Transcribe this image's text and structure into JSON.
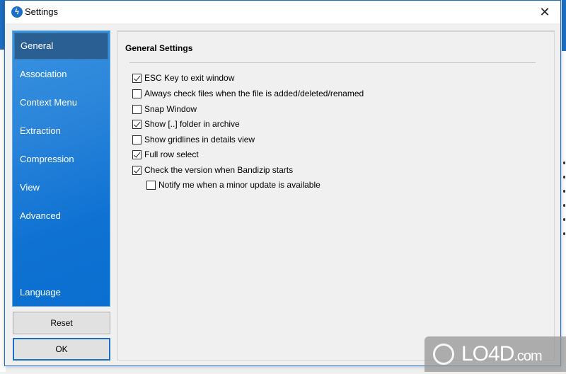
{
  "window": {
    "title": "Settings",
    "app_icon": "bandizip-bolt-icon",
    "close_glyph": "✕"
  },
  "sidebar": {
    "items": [
      {
        "label": "General",
        "active": true
      },
      {
        "label": "Association",
        "active": false
      },
      {
        "label": "Context Menu",
        "active": false
      },
      {
        "label": "Extraction",
        "active": false
      },
      {
        "label": "Compression",
        "active": false
      },
      {
        "label": "View",
        "active": false
      },
      {
        "label": "Advanced",
        "active": false
      },
      {
        "label": "Language",
        "active": false
      }
    ],
    "active_color": "#2a5f93",
    "background_color": "#0f72d3"
  },
  "buttons": {
    "reset_label": "Reset",
    "ok_label": "OK"
  },
  "general": {
    "section_title": "General Settings",
    "options": [
      {
        "label": "ESC Key to exit window",
        "checked": true,
        "indent": 0
      },
      {
        "label": "Always check files when the file is added/deleted/renamed",
        "checked": false,
        "indent": 0
      },
      {
        "label": "Snap Window",
        "checked": false,
        "indent": 0
      },
      {
        "label": "Show [..] folder in archive",
        "checked": true,
        "indent": 0
      },
      {
        "label": "Show gridlines in details view",
        "checked": false,
        "indent": 0
      },
      {
        "label": "Full row select",
        "checked": true,
        "indent": 0
      },
      {
        "label": "Check the version when Bandizip starts",
        "checked": true,
        "indent": 0
      },
      {
        "label": "Notify me when a minor update is available",
        "checked": false,
        "indent": 1
      }
    ]
  },
  "watermark": {
    "text": "LO4D",
    "suffix": ".com"
  },
  "colors": {
    "accent": "#1c6fc6"
  }
}
